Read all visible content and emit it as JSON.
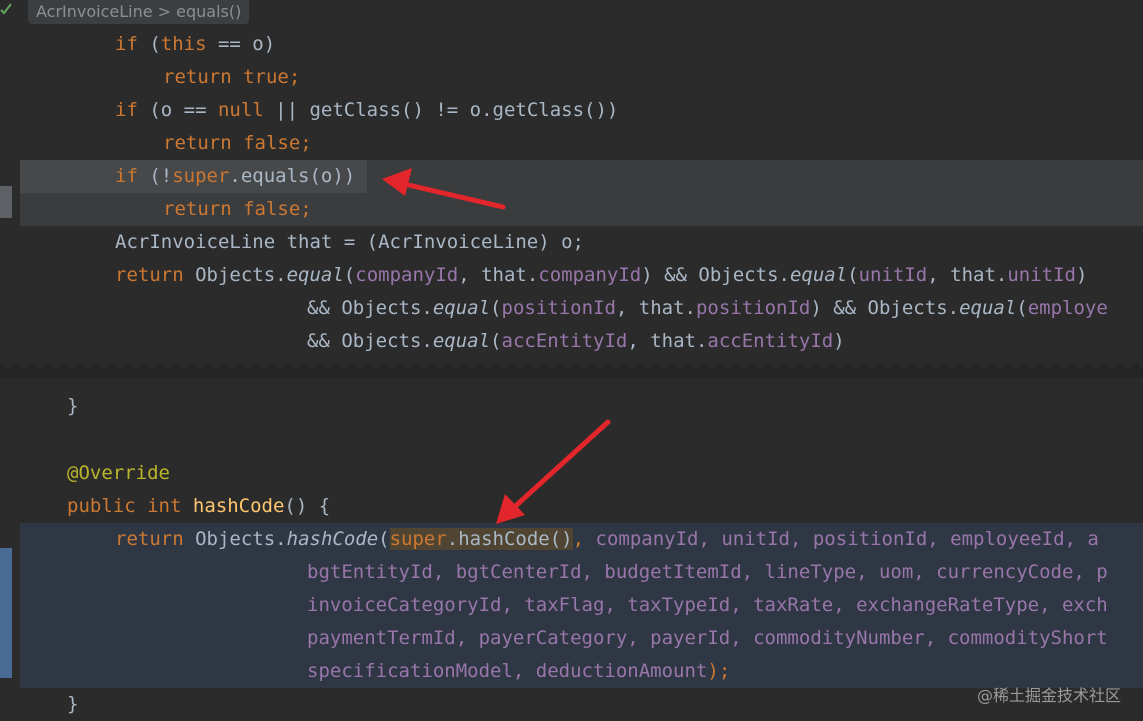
{
  "editor": {
    "breadcrumb": "AcrInvoiceLine > equals()"
  },
  "tokens": {
    "if": "if",
    "return": "return",
    "true": "true",
    "false": "false",
    "null": "null",
    "this": "this",
    "super": "super",
    "public": "public",
    "int": "int",
    "override": "@Override",
    "hashCode": "hashCode",
    "equal": "equal",
    "Objects": "Objects"
  },
  "code": {
    "l1_rest": " == o)",
    "l1_open": " (",
    "l3_mid": " (o == ",
    "l3_rest": " || getClass() != o.getClass())",
    "l5_open": " (!",
    "l5_rest": ".equals(o))",
    "l7": "AcrInvoiceLine that = (AcrInvoiceLine) o;",
    "l8_a": " Objects.",
    "l8_b": "(",
    "l8_f1": "companyId",
    "l8_c": ", that.",
    "l8_d": ") && Objects.",
    "l8_f2": "unitId",
    "l8_e": ", that.",
    "l8_g": ")",
    "l9_a": "&& Objects.",
    "l9_f1": "positionId",
    "l9_f2": "employe",
    "l10_f1": "accEntityId",
    "close_brace": "}",
    "hc_tail": "() {",
    "hc_dot": ".",
    "hc_call": "(",
    "hc_sup": ".hashCode()",
    "hc_comma": ", ",
    "hc_l1_fields": "companyId, unitId, positionId, employeeId, a",
    "hc_l2": "bgtEntityId, bgtCenterId, budgetItemId, lineType, uom, currencyCode, p",
    "hc_l3": "invoiceCategoryId, taxFlag, taxTypeId, taxRate, exchangeRateType, exch",
    "hc_l4": "paymentTermId, payerCategory, payerId, commodityNumber, commodityShort",
    "hc_l5": "specificationModel, deductionAmount",
    "hc_end": ");",
    "semicolon": ";"
  },
  "watermark": "@稀土掘金技术社区",
  "colors": {
    "background": "#2b2b2b",
    "keyword": "#cc7832",
    "field": "#9876aa",
    "method": "#ffc66d",
    "annotation": "#bbb529",
    "arrow": "#e3262b"
  }
}
